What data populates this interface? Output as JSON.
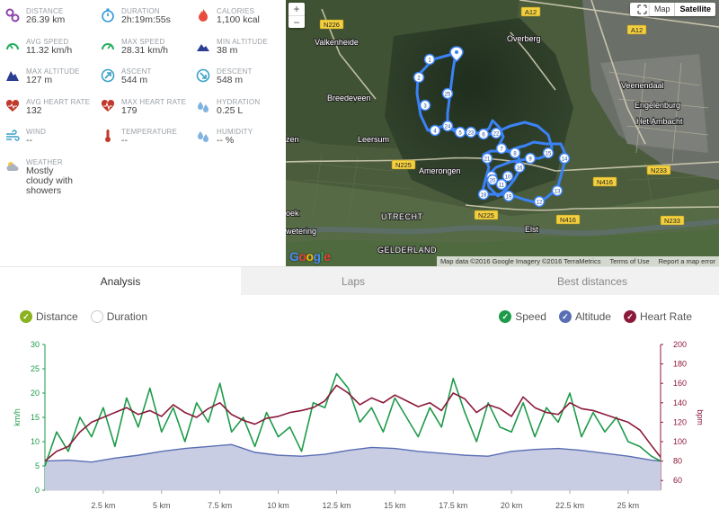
{
  "stats": [
    {
      "label": "DISTANCE",
      "value": "26.39 km",
      "icon": "distance-icon",
      "color": "#8e44ad"
    },
    {
      "label": "DURATION",
      "value": "2h:19m:55s",
      "icon": "stopwatch-icon",
      "color": "#3498db"
    },
    {
      "label": "CALORIES",
      "value": "1,100 kcal",
      "icon": "flame-icon",
      "color": "#e74c3c"
    },
    {
      "label": "AVG SPEED",
      "value": "11.32 km/h",
      "icon": "speedometer-icon",
      "color": "#27ae60"
    },
    {
      "label": "MAX SPEED",
      "value": "28.31 km/h",
      "icon": "speedometer-max-icon",
      "color": "#27ae60"
    },
    {
      "label": "MIN ALTITUDE",
      "value": "38 m",
      "icon": "mountain-low-icon",
      "color": "#2c3e91"
    },
    {
      "label": "MAX ALTITUDE",
      "value": "127 m",
      "icon": "mountain-high-icon",
      "color": "#2c3e91"
    },
    {
      "label": "ASCENT",
      "value": "544 m",
      "icon": "ascent-icon",
      "color": "#3aa0c8"
    },
    {
      "label": "DESCENT",
      "value": "548 m",
      "icon": "descent-icon",
      "color": "#3aa0c8"
    },
    {
      "label": "AVG HEART RATE",
      "value": "132",
      "icon": "heart-icon",
      "color": "#c0392b"
    },
    {
      "label": "MAX HEART RATE",
      "value": "179",
      "icon": "heart-max-icon",
      "color": "#c0392b"
    },
    {
      "label": "HYDRATION",
      "value": "0.25 L",
      "icon": "water-drops-icon",
      "color": "#7fb3e0"
    },
    {
      "label": "WIND",
      "value": "--",
      "icon": "wind-icon",
      "color": "#3aa0c8"
    },
    {
      "label": "TEMPERATURE",
      "value": "--",
      "icon": "thermometer-icon",
      "color": "#c0392b"
    },
    {
      "label": "HUMIDITY",
      "value": "-- %",
      "icon": "humidity-icon",
      "color": "#7fb3e0"
    },
    {
      "label": "WEATHER",
      "value": "Mostly cloudy with showers",
      "icon": "weather-cloud-icon",
      "color": "#aab4c0"
    }
  ],
  "map": {
    "zoom_in": "+",
    "zoom_out": "−",
    "type_map": "Map",
    "type_satellite": "Satellite",
    "footer": [
      "Map data ©2016 Google Imagery ©2016 TerraMetrics",
      "Terms of Use",
      "Report a map error"
    ],
    "logo": "Google",
    "places": [
      "Valkenheide",
      "Overberg",
      "Veenendaal",
      "Engelenburg",
      "Het Ambacht",
      "Breedeveen",
      "Leersum",
      "zen",
      "Amerongen",
      "oek",
      "UTRECHT",
      "wetering",
      "GELDERLAND",
      "Elst"
    ],
    "roads": [
      "N226",
      "A12",
      "A12",
      "N225",
      "N225",
      "N416",
      "N416",
      "N233",
      "N233"
    ],
    "markers": [
      "1",
      "2",
      "3",
      "4",
      "5",
      "6",
      "7",
      "8",
      "9",
      "10",
      "11",
      "12",
      "13",
      "14",
      "15",
      "16",
      "17",
      "18",
      "19",
      "20",
      "21",
      "22",
      "23",
      "24",
      "25"
    ]
  },
  "tabs": [
    "Analysis",
    "Laps",
    "Best distances"
  ],
  "legend_left": [
    {
      "label": "Distance",
      "checked": true,
      "color": "#8ab21e"
    },
    {
      "label": "Duration",
      "checked": false,
      "color": "#cccccc"
    }
  ],
  "legend_right": [
    {
      "label": "Speed",
      "checked": true,
      "color": "#1e9b4a"
    },
    {
      "label": "Altitude",
      "checked": true,
      "color": "#5a6eb4"
    },
    {
      "label": "Heart Rate",
      "checked": true,
      "color": "#8b1a3a"
    }
  ],
  "chart_data": {
    "type": "line",
    "x_unit": "km",
    "x_ticks": [
      "2.5 km",
      "5 km",
      "7.5 km",
      "10 km",
      "12.5 km",
      "15 km",
      "17.5 km",
      "20 km",
      "22.5 km",
      "25 km"
    ],
    "xlim": [
      0,
      26.39
    ],
    "y_left": {
      "label": "km/h",
      "ticks": [
        0,
        5,
        10,
        15,
        20,
        25,
        30
      ],
      "lim": [
        0,
        30
      ],
      "color": "#1e9b4a"
    },
    "y_right": {
      "label": "bpm",
      "ticks": [
        60,
        80,
        100,
        120,
        140,
        160,
        180,
        200
      ],
      "lim": [
        50,
        200
      ],
      "color": "#8b1a3a"
    },
    "series": [
      {
        "name": "Speed",
        "color": "#1e9b4a",
        "x": [
          0,
          0.5,
          1,
          1.5,
          2,
          2.5,
          3,
          3.5,
          4,
          4.5,
          5,
          5.5,
          6,
          6.5,
          7,
          7.5,
          8,
          8.5,
          9,
          9.5,
          10,
          10.5,
          11,
          11.5,
          12,
          12.5,
          13,
          13.5,
          14,
          14.5,
          15,
          15.5,
          16,
          16.5,
          17,
          17.5,
          18,
          18.5,
          19,
          19.5,
          20,
          20.5,
          21,
          21.5,
          22,
          22.5,
          23,
          23.5,
          24,
          24.5,
          25,
          25.5,
          26,
          26.39
        ],
        "values": [
          5,
          12,
          8,
          15,
          11,
          17,
          9,
          19,
          13,
          21,
          12,
          17,
          10,
          18,
          14,
          22,
          12,
          15,
          9,
          16,
          11,
          13,
          8,
          18,
          17,
          24,
          21,
          14,
          17,
          12,
          19,
          15,
          11,
          17,
          13,
          23,
          16,
          10,
          18,
          13,
          12,
          18,
          11,
          17,
          14,
          20,
          11,
          16,
          12,
          15,
          10,
          9,
          7,
          6
        ]
      },
      {
        "name": "Altitude",
        "color": "#5a6eb4",
        "x": [
          0,
          1,
          2,
          3,
          4,
          5,
          6,
          7,
          8,
          9,
          10,
          11,
          12,
          13,
          14,
          15,
          16,
          17,
          18,
          19,
          20,
          21,
          22,
          23,
          24,
          25,
          26,
          26.39
        ],
        "values": [
          60,
          62,
          58,
          66,
          72,
          80,
          86,
          90,
          94,
          78,
          72,
          70,
          74,
          82,
          88,
          86,
          80,
          76,
          72,
          70,
          80,
          84,
          86,
          82,
          76,
          70,
          62,
          60
        ]
      },
      {
        "name": "Heart Rate",
        "color": "#8b1a3a",
        "x": [
          0,
          0.5,
          1,
          1.5,
          2,
          2.5,
          3,
          3.5,
          4,
          4.5,
          5,
          5.5,
          6,
          6.5,
          7,
          7.5,
          8,
          8.5,
          9,
          9.5,
          10,
          10.5,
          11,
          11.5,
          12,
          12.5,
          13,
          13.5,
          14,
          14.5,
          15,
          15.5,
          16,
          16.5,
          17,
          17.5,
          18,
          18.5,
          19,
          19.5,
          20,
          20.5,
          21,
          21.5,
          22,
          22.5,
          23,
          23.5,
          24,
          24.5,
          25,
          25.5,
          26,
          26.39
        ],
        "values": [
          80,
          90,
          95,
          110,
          120,
          125,
          130,
          135,
          128,
          132,
          126,
          138,
          130,
          125,
          134,
          140,
          128,
          122,
          118,
          124,
          126,
          130,
          132,
          135,
          142,
          158,
          150,
          138,
          145,
          140,
          148,
          142,
          136,
          140,
          132,
          150,
          144,
          130,
          138,
          134,
          126,
          146,
          135,
          130,
          128,
          140,
          134,
          132,
          128,
          124,
          120,
          112,
          96,
          84
        ]
      }
    ]
  }
}
